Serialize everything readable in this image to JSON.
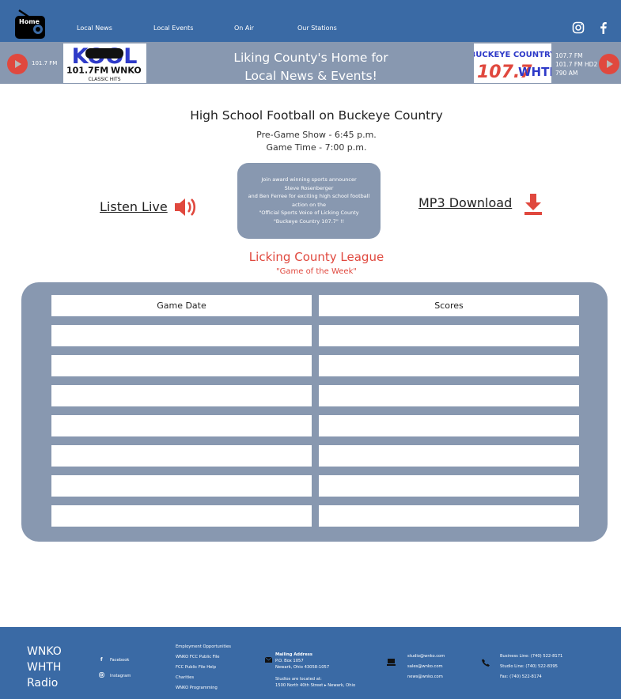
{
  "nav": {
    "home_label": "Home",
    "links": [
      "Local News",
      "Local Events",
      "On Air",
      "Our Stations"
    ],
    "social_icons": [
      "instagram-icon",
      "facebook-icon"
    ]
  },
  "station_bar": {
    "left_freq": "101.7 FM",
    "right_freqs": [
      "107.7 FM",
      "101.7 FM HD2",
      "790 AM"
    ],
    "headline_line1": "Liking County's Home for",
    "headline_line2": "Local News & Events!",
    "kool_logo": {
      "word": "KOOL",
      "freq": "101.7FM",
      "call": "WNKO",
      "tag": "CLASSIC HITS"
    },
    "buckeye_logo": {
      "word": "BUCKEYE COUNTRY",
      "freq": "107.7",
      "call": "WHTH"
    },
    "colors": {
      "bar": "#8898b0",
      "play": "#e0483e"
    }
  },
  "main": {
    "title": "High School Football on Buckeye Country",
    "pregame": "Pre-Game Show - 6:45 p.m.",
    "gametime": "Game Time - 7:00 p.m.",
    "info": [
      "Join award winning sports announcer",
      "Steve Rosenberger",
      "and Ben Ferree for exciting high school football",
      "action on the",
      "\"Official Sports Voice of Licking County",
      "\"Buckeye Country 107.7\" !!"
    ],
    "listen_label": "Listen Live",
    "mp3_label": "MP3 Download",
    "league_title": "Licking County League",
    "league_sub": "\"Game of the Week\"",
    "accent": "#e0483e"
  },
  "schedule": {
    "headers": [
      "Game Date",
      "Scores"
    ],
    "rows": [
      [
        "",
        ""
      ],
      [
        "",
        ""
      ],
      [
        "",
        ""
      ],
      [
        "",
        ""
      ],
      [
        "",
        ""
      ],
      [
        "",
        ""
      ],
      [
        "",
        ""
      ]
    ]
  },
  "footer": {
    "brand": [
      "WNKO",
      "WHTH",
      "Radio"
    ],
    "social": [
      "Facebook",
      "Instagram"
    ],
    "links": [
      "Employment Opportunities",
      "WNKO FCC Public File",
      "FCC Public File Help",
      "Charities",
      "WNKO Programming"
    ],
    "mail_title": "Mailing Address",
    "mail_lines": [
      "P.O. Box 1057",
      "Newark, Ohio 43058-1057"
    ],
    "studio_title": "Studios are located at:",
    "studio_line": "1500 North 40th Street ▸ Newark, Ohio",
    "emails": [
      "studio@wnko.com",
      "sales@wnko.com",
      "news@wnko.com"
    ],
    "phones": [
      "Business Line: (740) 522-8171",
      "Studio Line: (740) 522-8395",
      "Fax: (740) 522-8174"
    ],
    "color": "#3a6aa5"
  }
}
